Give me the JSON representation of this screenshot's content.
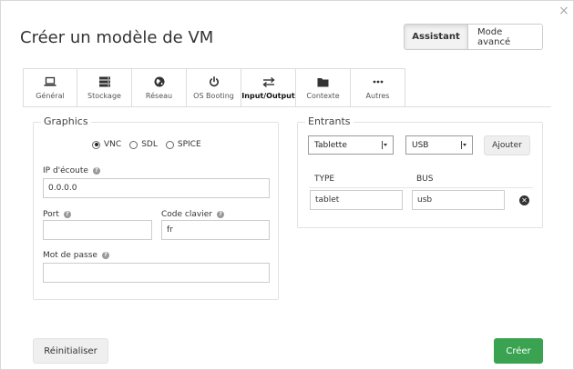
{
  "dialog": {
    "title": "Créer un modèle de VM",
    "close_glyph": "×",
    "close_icon": "close-icon"
  },
  "modes": {
    "assistant": "Assistant",
    "advanced": "Mode avancé",
    "active": "assistant"
  },
  "tabs": [
    {
      "label": "Général",
      "icon": "laptop-icon"
    },
    {
      "label": "Stockage",
      "icon": "database-icon"
    },
    {
      "label": "Réseau",
      "icon": "globe-icon"
    },
    {
      "label": "OS Booting",
      "icon": "power-icon"
    },
    {
      "label": "Input/Output",
      "icon": "exchange-icon",
      "active": true
    },
    {
      "label": "Contexte",
      "icon": "folder-icon"
    },
    {
      "label": "Autres",
      "icon": "ellipsis-icon"
    }
  ],
  "graphics": {
    "legend": "Graphics",
    "options": [
      {
        "label": "VNC",
        "checked": true
      },
      {
        "label": "SDL",
        "checked": false
      },
      {
        "label": "SPICE",
        "checked": false
      }
    ],
    "listen_ip": {
      "label": "IP d'écoute",
      "value": "0.0.0.0"
    },
    "port": {
      "label": "Port",
      "value": ""
    },
    "keymap": {
      "label": "Code clavier",
      "value": "fr"
    },
    "password": {
      "label": "Mot de passe",
      "value": ""
    },
    "help_glyph": "?"
  },
  "inputs": {
    "legend": "Entrants",
    "type_select": "Tablette",
    "bus_select": "USB",
    "add_label": "Ajouter",
    "col_type": "TYPE",
    "col_bus": "BUS",
    "rows": [
      {
        "type": "tablet",
        "bus": "usb"
      }
    ],
    "remove_glyph": "✕"
  },
  "footer": {
    "reset": "Réinitialiser",
    "create": "Créer"
  },
  "colors": {
    "create_button": "#3aa352"
  }
}
